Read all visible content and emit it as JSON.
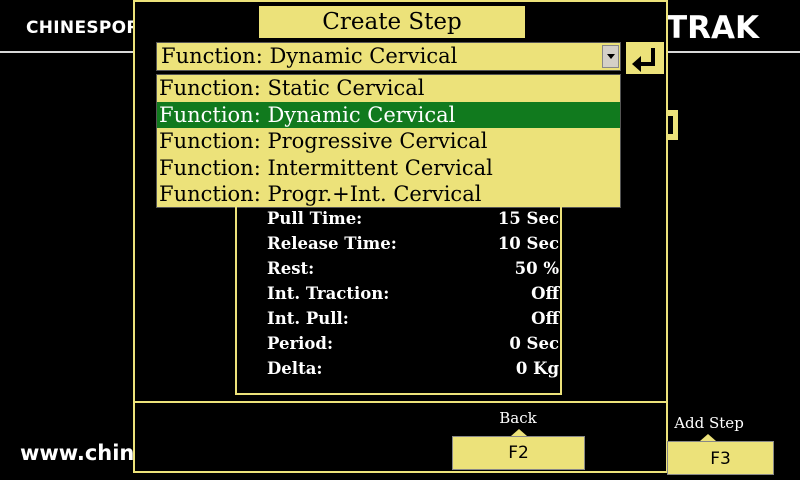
{
  "brand": {
    "left": "CHINESPORT",
    "right": "TRAK",
    "website": "www.chine"
  },
  "dialog": {
    "title": "Create Step",
    "select_value": "Function: Dynamic Cervical",
    "options": [
      "Function: Static Cervical",
      "Function: Dynamic Cervical",
      "Function: Progressive Cervical",
      "Function: Intermittent Cervical",
      "Function: Progr.+Int. Cervical"
    ],
    "selected_index": 1,
    "params": [
      {
        "label": "Pull Time:",
        "value": "15 Sec"
      },
      {
        "label": "Release Time:",
        "value": "10 Sec"
      },
      {
        "label": "Rest:",
        "value": "50 %"
      },
      {
        "label": "Int. Traction:",
        "value": "Off"
      },
      {
        "label": "Int. Pull:",
        "value": "Off"
      },
      {
        "label": "Period:",
        "value": "0 Sec"
      },
      {
        "label": "Delta:",
        "value": "0 Kg"
      }
    ]
  },
  "softkeys": {
    "back_label": "Back",
    "back_key": "F2",
    "add_label": "Add Step",
    "add_key": "F3"
  },
  "colors": {
    "accent": "#ece27a",
    "selection": "#117a1e",
    "background": "#000000"
  },
  "icons": {
    "enter": "enter-return-icon",
    "dropdown": "chevron-down-icon"
  }
}
